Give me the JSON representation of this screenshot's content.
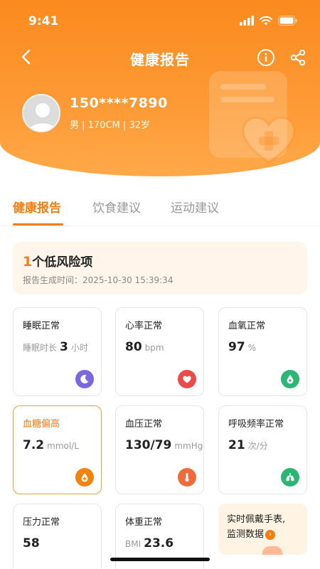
{
  "status_bar": {
    "time": "9:41"
  },
  "nav": {
    "title": "健康报告"
  },
  "user": {
    "phone": "150****7890",
    "info": "男 | 170CM | 32岁"
  },
  "tabs": [
    {
      "label": "健康报告",
      "active": true
    },
    {
      "label": "饮食建议",
      "active": false
    },
    {
      "label": "运动建议",
      "active": false
    }
  ],
  "risk": {
    "count": "1",
    "label": "个低风险项",
    "generated": "报告生成时间：2025-10-30  15:39:34"
  },
  "cards": [
    {
      "title": "睡眠正常",
      "prefix": "睡眠时长",
      "value": "3",
      "unit": "小时",
      "icon": "moon-icon",
      "icon_color": "#7b68e0"
    },
    {
      "title": "心率正常",
      "prefix": "",
      "value": "80",
      "unit": "bpm",
      "icon": "heart-icon",
      "icon_color": "#ec4b4b"
    },
    {
      "title": "血氧正常",
      "prefix": "",
      "value": "97",
      "unit": "%",
      "icon": "oxygen-icon",
      "icon_color": "#2bb673"
    },
    {
      "title": "血糖偏高",
      "prefix": "",
      "value": "7.2",
      "unit": "mmol/L",
      "icon": "blood-drop-icon",
      "icon_color": "#f2840e",
      "warn": true
    },
    {
      "title": "血压正常",
      "prefix": "",
      "value": "130/79",
      "unit": "mmHg",
      "icon": "thermometer-icon",
      "icon_color": "#f06a3c"
    },
    {
      "title": "呼吸频率正常",
      "prefix": "",
      "value": "21",
      "unit": "次/分",
      "icon": "lungs-icon",
      "icon_color": "#2bb673"
    },
    {
      "title": "压力正常",
      "prefix": "",
      "value": "58",
      "unit": "",
      "icon": "",
      "icon_color": ""
    },
    {
      "title": "体重正常",
      "prefix": "BMI",
      "value": "23.6",
      "unit": "",
      "icon": "",
      "icon_color": ""
    }
  ],
  "promo": {
    "line1": "实时佩戴手表,",
    "line2": "监测数据"
  },
  "colors": {
    "accent": "#f57e13",
    "header": "#fb8a1f"
  }
}
